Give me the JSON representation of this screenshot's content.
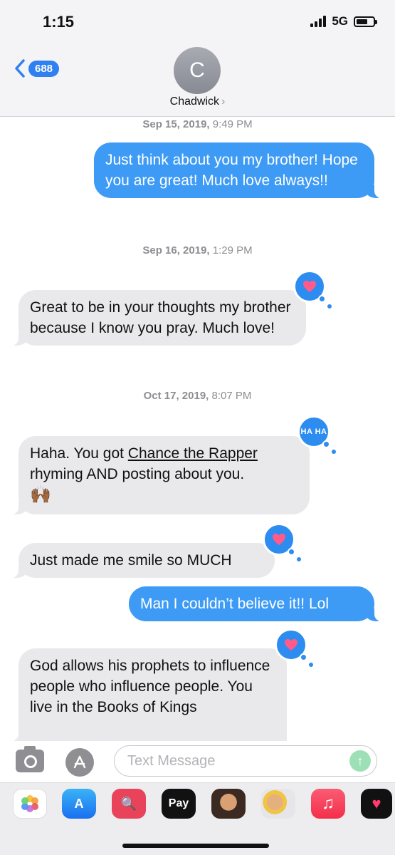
{
  "status": {
    "time": "1:15",
    "network": "5G"
  },
  "header": {
    "back_count": "688",
    "avatar_initial": "C",
    "contact_name": "Chadwick",
    "contact_arrow": "›"
  },
  "messages": [
    {
      "timestamp_date": "Sep 15, 2019,",
      "timestamp_time": "9:49 PM"
    },
    {
      "text": "Just think about you my brother! Hope you are great! Much love always!!"
    },
    {
      "timestamp_date": "Sep 16, 2019,",
      "timestamp_time": "1:29 PM"
    },
    {
      "text": "Great to be in your thoughts my brother because I know you pray. Much love!",
      "reaction": "heart"
    },
    {
      "timestamp_date": "Oct 17, 2019,",
      "timestamp_time": "8:07 PM"
    },
    {
      "text_before_link": "Haha.  You got ",
      "link_text": "Chance the Rapper",
      "text_after_link": " rhyming AND posting about you.",
      "emoji": "🙌🏾",
      "reaction": "haha",
      "reaction_label": "HA HA"
    },
    {
      "text": "Just made me smile so MUCH",
      "reaction": "heart"
    },
    {
      "text": "Man I couldn’t believe it!! Lol"
    },
    {
      "text": "God allows his prophets to influence people who influence people. You live in the Books of Kings",
      "reaction": "heart"
    }
  ],
  "input": {
    "placeholder": "Text Message"
  },
  "drawer": {
    "apps": [
      {
        "name": "photos",
        "label": ""
      },
      {
        "name": "app-store",
        "label": "A"
      },
      {
        "name": "images-search",
        "label": "🔍"
      },
      {
        "name": "apple-pay",
        "label": " Pay"
      },
      {
        "name": "memoji",
        "label": ""
      },
      {
        "name": "memoji-stickers",
        "label": ""
      },
      {
        "name": "music",
        "label": "♫"
      },
      {
        "name": "digital-touch",
        "label": "♥"
      }
    ]
  },
  "colors": {
    "sent_bubble": "#3e9bf5",
    "received_bubble": "#e9e9eb",
    "tapback": "#2d8cf0",
    "badge": "#2f80f0"
  }
}
